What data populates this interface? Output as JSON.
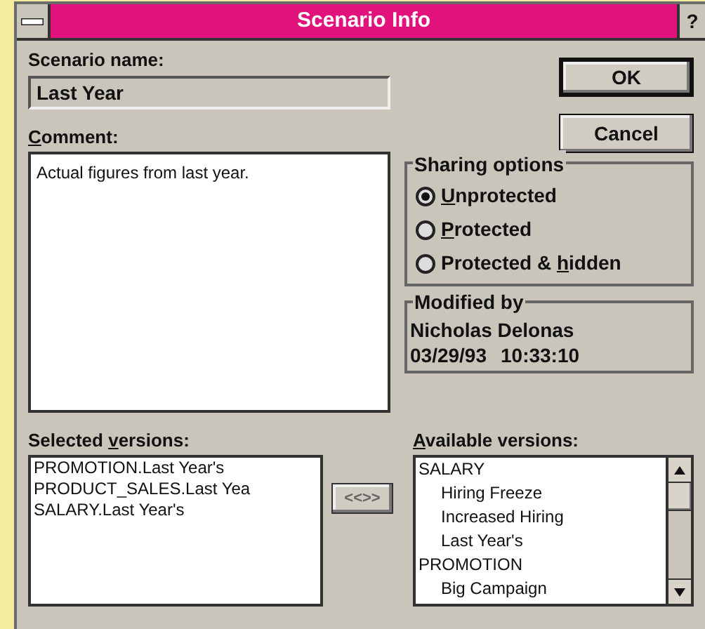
{
  "window": {
    "title": "Scenario Info",
    "help": "?"
  },
  "scenario_name": {
    "label": "Scenario name:",
    "value": "Last Year"
  },
  "comment": {
    "label": {
      "key": "C",
      "post": "omment:"
    },
    "value": "Actual figures from last year."
  },
  "buttons": [
    {
      "label": "OK",
      "default": true
    },
    {
      "label": "Cancel",
      "default": false
    }
  ],
  "sharing_options": {
    "title": "Sharing options",
    "options": [
      {
        "label": {
          "key": "U",
          "post": "nprotected"
        },
        "selected": true
      },
      {
        "label": {
          "key": "P",
          "post": "rotected"
        },
        "selected": false
      },
      {
        "label": {
          "pre": "Protected & ",
          "key": "h",
          "post": "idden"
        },
        "selected": false
      }
    ]
  },
  "modified_by": {
    "title": "Modified by",
    "name": "Nicholas Delonas",
    "date": "03/29/93",
    "time": "10:33:10"
  },
  "selected_versions": {
    "label": {
      "pre": "Selected ",
      "key": "v",
      "post": "ersions:"
    },
    "items": [
      "PROMOTION.Last Year's",
      "PRODUCT_SALES.Last Yea",
      "SALARY.Last Year's"
    ]
  },
  "swap_button": {
    "label": "<<>>"
  },
  "available_versions": {
    "label": {
      "key": "A",
      "post": "vailable versions:"
    },
    "items": [
      {
        "label": "SALARY",
        "children": [
          {
            "label": "Hiring Freeze"
          },
          {
            "label": "Increased Hiring"
          },
          {
            "label": "Last Year's"
          }
        ]
      },
      {
        "label": "PROMOTION",
        "children": [
          {
            "label": "Big Campaign"
          }
        ]
      }
    ]
  }
}
